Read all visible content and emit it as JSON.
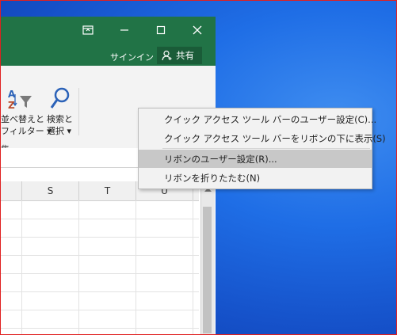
{
  "title_bar": {
    "controls": [
      "ribbon-display-options",
      "minimize",
      "maximize",
      "close"
    ],
    "signin_label": "サインイン",
    "share_label": "共有"
  },
  "ribbon": {
    "sort_filter": {
      "line1": "並べ替えと",
      "line2": "フィルター ▾"
    },
    "find_select": {
      "line1": "検索と",
      "line2": "選択 ▾"
    },
    "group_label": "集"
  },
  "columns": [
    "S",
    "T",
    "U"
  ],
  "context_menu": {
    "items": [
      {
        "label": "クイック アクセス ツール バーのユーザー設定(C)...",
        "highlighted": false
      },
      {
        "label": "クイック アクセス ツール バーをリボンの下に表示(S)",
        "highlighted": false
      },
      {
        "label": "リボンのユーザー設定(R)...",
        "highlighted": true
      },
      {
        "label": "リボンを折りたたむ(N)",
        "highlighted": false
      }
    ]
  },
  "colors": {
    "excel_green": "#217346",
    "desktop_blue": "#1f6ee6",
    "highlight": "#c8c8c8"
  }
}
